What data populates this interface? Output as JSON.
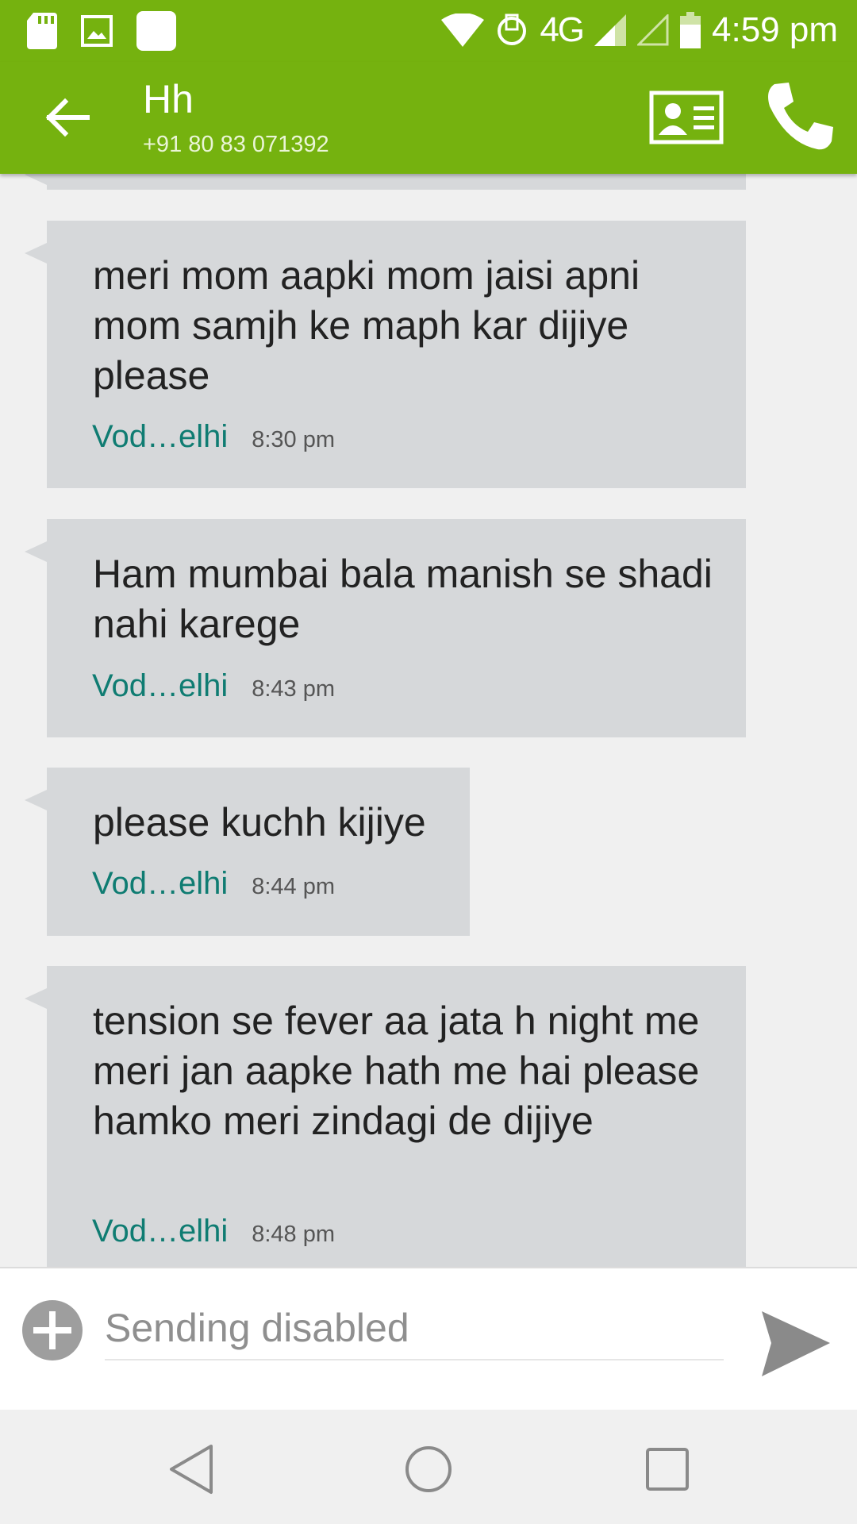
{
  "status_bar": {
    "time": "4:59 pm",
    "network": "4G",
    "icons": [
      "sd-card-icon",
      "gallery-icon",
      "app-icon",
      "wifi-icon",
      "data-saver-icon",
      "signal-icon",
      "signal-empty-icon",
      "battery-icon"
    ]
  },
  "header": {
    "contact_name": "Hh",
    "contact_number": "+91 80 83 071392",
    "icons": [
      "back-arrow-icon",
      "contact-card-icon",
      "phone-icon"
    ]
  },
  "messages": [
    {
      "text": "meri mom aapki mom jaisi apni mom samjh ke maph kar dijiye please",
      "sim": "Vod…elhi",
      "time": "8:30 pm"
    },
    {
      "text": "Ham mumbai bala manish se shadi nahi karege",
      "sim": "Vod…elhi",
      "time": "8:43 pm"
    },
    {
      "text": "please kuchh kijiye",
      "sim": "Vod…elhi",
      "time": "8:44 pm"
    },
    {
      "text": "tension se fever aa jata h night me meri jan aapke hath me hai please hamko meri zindagi de dijiye",
      "sim": "Vod…elhi",
      "time": "8:48 pm"
    }
  ],
  "composer": {
    "placeholder": "Sending disabled",
    "icons": [
      "add-attachment-icon",
      "send-icon"
    ]
  },
  "nav": {
    "icons": [
      "nav-back-icon",
      "nav-home-icon",
      "nav-recents-icon"
    ]
  },
  "colors": {
    "app_bar": "#75b20f",
    "bubble": "#d6d8da",
    "sim_label": "#0f7c72"
  }
}
